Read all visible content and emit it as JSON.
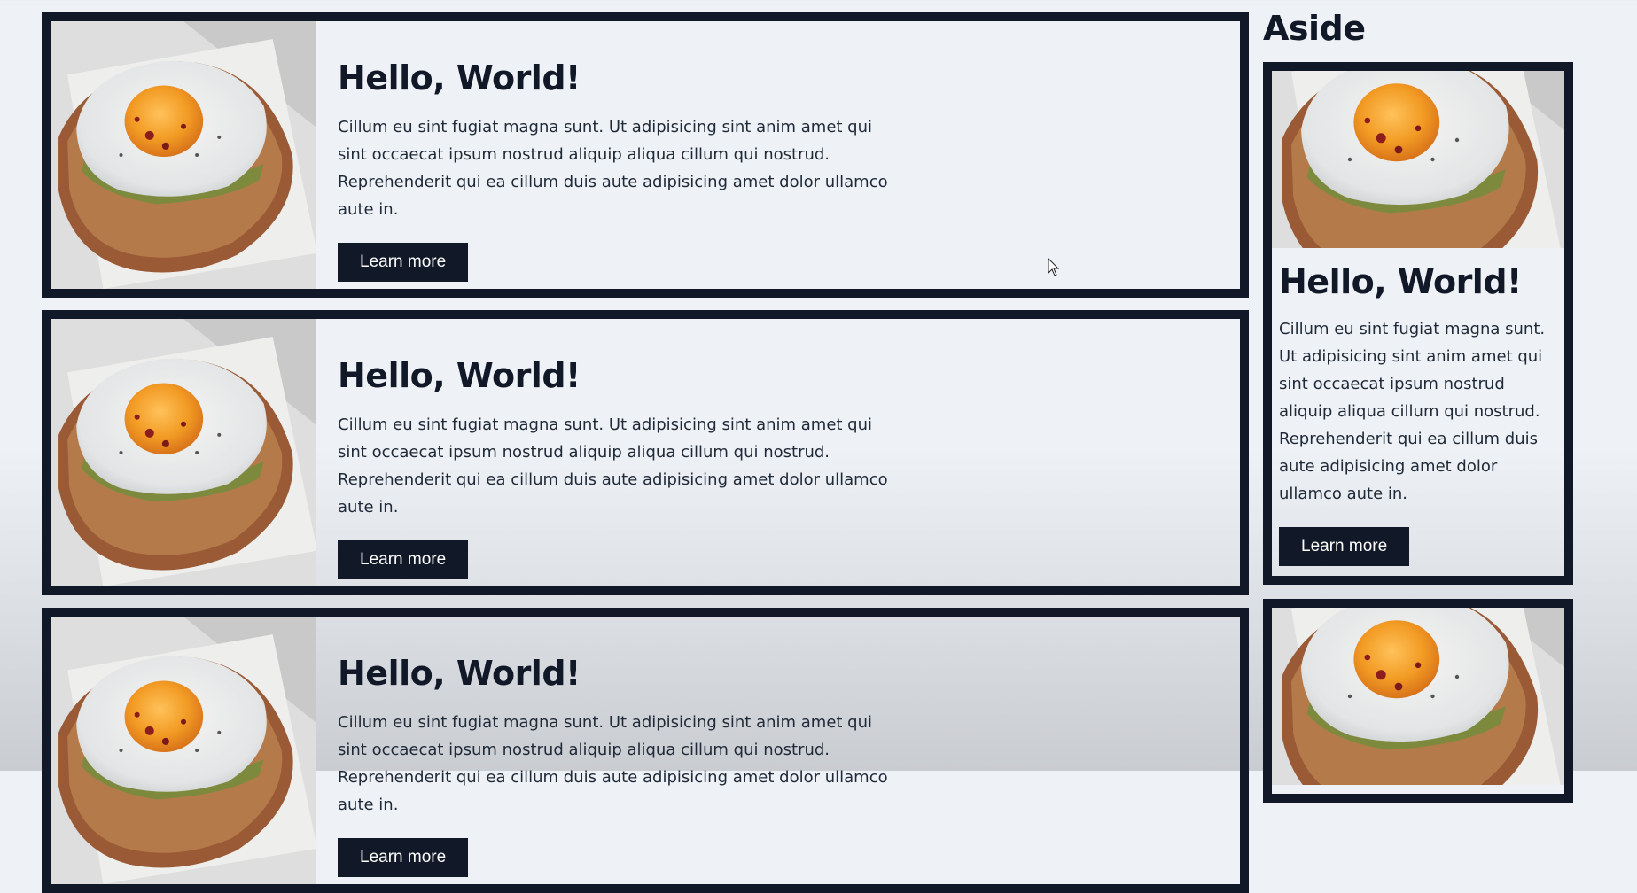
{
  "cards": [
    {
      "title": "Hello, World!",
      "text": "Cillum eu sint fugiat magna sunt. Ut adipisicing sint anim amet qui sint occaecat ipsum nostrud aliquip aliqua cillum qui nostrud. Reprehenderit qui ea cillum duis aute adipisicing amet dolor ullamco aute in.",
      "button": "Learn more"
    },
    {
      "title": "Hello, World!",
      "text": "Cillum eu sint fugiat magna sunt. Ut adipisicing sint anim amet qui sint occaecat ipsum nostrud aliquip aliqua cillum qui nostrud. Reprehenderit qui ea cillum duis aute adipisicing amet dolor ullamco aute in.",
      "button": "Learn more"
    },
    {
      "title": "Hello, World!",
      "text": "Cillum eu sint fugiat magna sunt. Ut adipisicing sint anim amet qui sint occaecat ipsum nostrud aliquip aliqua cillum qui nostrud. Reprehenderit qui ea cillum duis aute adipisicing amet dolor ullamco aute in.",
      "button": "Learn more"
    }
  ],
  "aside": {
    "heading": "Aside",
    "cards": [
      {
        "title": "Hello, World!",
        "text": "Cillum eu sint fugiat magna sunt. Ut adipisicing sint anim amet qui sint occaecat ipsum nostrud aliquip aliqua cillum qui nostrud. Reprehenderit qui ea cillum duis aute adipisicing amet dolor ullamco aute in.",
        "button": "Learn more"
      }
    ]
  },
  "colors": {
    "dark": "#111827",
    "background": "#eef2f6"
  },
  "image": "fried-egg-on-toast-photo"
}
